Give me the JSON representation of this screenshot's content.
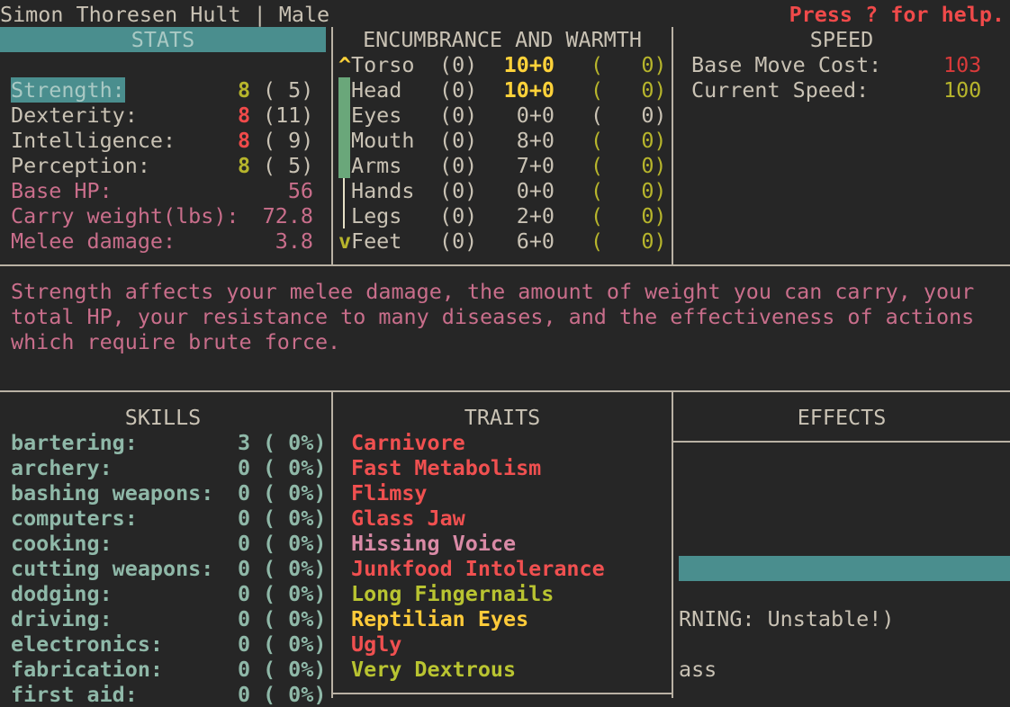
{
  "header": {
    "character": "Simon Thoresen Hult | Male",
    "help_hint": "Press ? for help."
  },
  "stats": {
    "title": "STATS",
    "rows": [
      {
        "label": "Strength:",
        "current": "8",
        "base": "( 5)",
        "current_color": "#b7b52c",
        "selected": true
      },
      {
        "label": "Dexterity:",
        "current": "8",
        "base": "(11)",
        "current_color": "#f04a4a",
        "selected": false
      },
      {
        "label": "Intelligence:",
        "current": "8",
        "base": "( 9)",
        "current_color": "#f04a4a",
        "selected": false
      },
      {
        "label": "Perception:",
        "current": "8",
        "base": "( 5)",
        "current_color": "#b7b52c",
        "selected": false
      }
    ],
    "derived": [
      {
        "label": "Base HP:",
        "value": "56"
      },
      {
        "label": "Carry weight(lbs):",
        "value": "72.8"
      },
      {
        "label": "Melee damage:",
        "value": "3.8"
      }
    ]
  },
  "encumbrance": {
    "title": "ENCUMBRANCE AND WARMTH",
    "scroll_up": "^",
    "scroll_down": "v",
    "rows": [
      {
        "part": "Torso",
        "enc": "(0)",
        "layers": "10+0",
        "warmth": "(   0)",
        "layers_color": "#ffd23a",
        "warmth_color": "#b7b52c"
      },
      {
        "part": "Head",
        "enc": "(0)",
        "layers": "10+0",
        "warmth": "(   0)",
        "layers_color": "#ffd23a",
        "warmth_color": "#b7b52c"
      },
      {
        "part": "Eyes",
        "enc": "(0)",
        "layers": "0+0",
        "warmth": "(   0)",
        "layers_color": "#c9c2b4",
        "warmth_color": "#c9c2b4"
      },
      {
        "part": "Mouth",
        "enc": "(0)",
        "layers": "8+0",
        "warmth": "(   0)",
        "layers_color": "#c9c2b4",
        "warmth_color": "#b7b52c"
      },
      {
        "part": "Arms",
        "enc": "(0)",
        "layers": "7+0",
        "warmth": "(   0)",
        "layers_color": "#c9c2b4",
        "warmth_color": "#b7b52c"
      },
      {
        "part": "Hands",
        "enc": "(0)",
        "layers": "0+0",
        "warmth": "(   0)",
        "layers_color": "#c9c2b4",
        "warmth_color": "#b7b52c"
      },
      {
        "part": "Legs",
        "enc": "(0)",
        "layers": "2+0",
        "warmth": "(   0)",
        "layers_color": "#c9c2b4",
        "warmth_color": "#b7b52c"
      },
      {
        "part": "Feet",
        "enc": "(0)",
        "layers": "6+0",
        "warmth": "(   0)",
        "layers_color": "#c9c2b4",
        "warmth_color": "#b7b52c"
      }
    ]
  },
  "speed": {
    "title": "SPEED",
    "rows": [
      {
        "label": "Base Move Cost:",
        "value": "103",
        "color": "#d93a3a"
      },
      {
        "label": "Current Speed:",
        "value": "100",
        "color": "#b7b52c"
      }
    ]
  },
  "description": {
    "lines": [
      "Strength affects your melee damage, the amount of weight you can carry, your",
      "total HP, your resistance to many diseases, and the effectiveness of actions",
      "which require brute force."
    ]
  },
  "skills": {
    "title": "SKILLS",
    "rows": [
      {
        "name": "bartering:",
        "level": "3",
        "pct": "( 0%)"
      },
      {
        "name": "archery:",
        "level": "0",
        "pct": "( 0%)"
      },
      {
        "name": "bashing weapons:",
        "level": "0",
        "pct": "( 0%)"
      },
      {
        "name": "computers:",
        "level": "0",
        "pct": "( 0%)"
      },
      {
        "name": "cooking:",
        "level": "0",
        "pct": "( 0%)"
      },
      {
        "name": "cutting weapons:",
        "level": "0",
        "pct": "( 0%)"
      },
      {
        "name": "dodging:",
        "level": "0",
        "pct": "( 0%)"
      },
      {
        "name": "driving:",
        "level": "0",
        "pct": "( 0%)"
      },
      {
        "name": "electronics:",
        "level": "0",
        "pct": "( 0%)"
      },
      {
        "name": "fabrication:",
        "level": "0",
        "pct": "( 0%)"
      },
      {
        "name": "first aid:",
        "level": "0",
        "pct": "( 0%)"
      }
    ]
  },
  "traits": {
    "title": "TRAITS",
    "items": [
      {
        "name": "Carnivore",
        "color": "#f05050"
      },
      {
        "name": "Fast Metabolism",
        "color": "#f05050"
      },
      {
        "name": "Flimsy",
        "color": "#f05050"
      },
      {
        "name": "Glass Jaw",
        "color": "#f05050"
      },
      {
        "name": "Hissing Voice",
        "color": "#d98aa6"
      },
      {
        "name": "Junkfood Intolerance",
        "color": "#f05050"
      },
      {
        "name": "Long Fingernails",
        "color": "#b9c431"
      },
      {
        "name": "Reptilian Eyes",
        "color": "#ffcb3a"
      },
      {
        "name": "Ugly",
        "color": "#f05050"
      },
      {
        "name": "Very Dextrous",
        "color": "#b9c431"
      }
    ]
  },
  "effects": {
    "title": "EFFECTS",
    "line1": "RNING: Unstable!)",
    "line2": "ass"
  },
  "colors": {
    "selection_bg": "#4a8e8e",
    "encumbrance_bar": "#6aa77a",
    "border": "#b9b1a4",
    "background": "#262626"
  }
}
